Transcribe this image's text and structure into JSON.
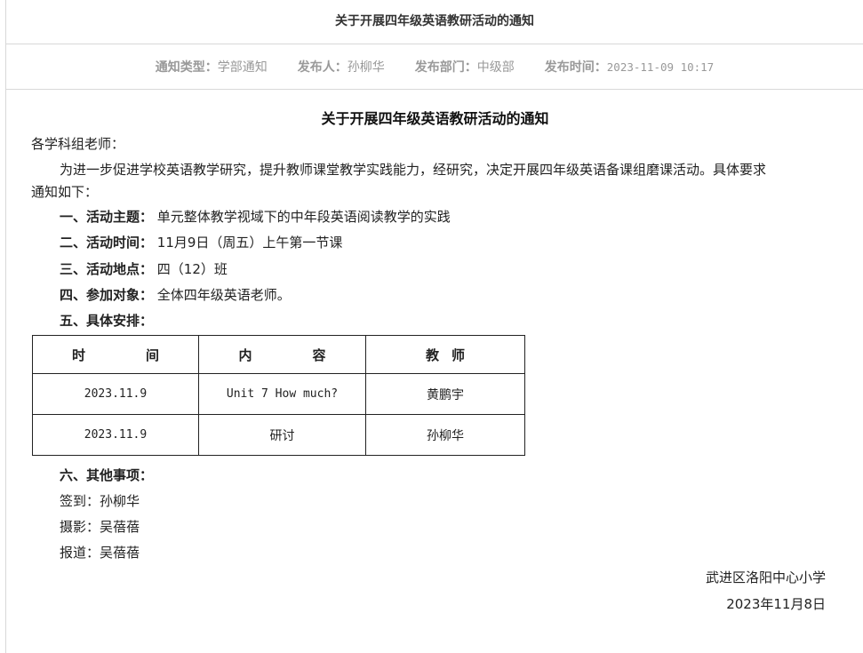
{
  "header": {
    "title": "关于开展四年级英语教研活动的通知"
  },
  "meta": {
    "type_label": "通知类型：",
    "type_value": "学部通知",
    "publisher_label": "发布人：",
    "publisher_value": "孙柳华",
    "dept_label": "发布部门：",
    "dept_value": "中级部",
    "time_label": "发布时间：",
    "time_value": "2023-11-09 10:17"
  },
  "doc": {
    "title": "关于开展四年级英语教研活动的通知",
    "salutation": "各学科组老师：",
    "intro_line1": "为进一步促进学校英语教学研究，提升教师课堂教学实践能力，经研究，决定开展四年级英语备课组磨课活动。具体要求",
    "intro_line2": "通知如下：",
    "items": [
      {
        "label": "一、活动主题：",
        "value": "单元整体教学视域下的中年段英语阅读教学的实践"
      },
      {
        "label": "二、活动时间：",
        "value": "11月9日（周五）上午第一节课"
      },
      {
        "label": "三、活动地点：",
        "value": "四（12）班"
      },
      {
        "label": "四、参加对象：",
        "value": "全体四年级英语老师。"
      },
      {
        "label": "五、具体安排：",
        "value": ""
      }
    ],
    "table": {
      "headers": [
        "时",
        "间",
        "内",
        "容",
        "教",
        "师"
      ],
      "rows": [
        {
          "time": "2023.11.9",
          "content": "Unit 7 How much?",
          "teacher": "黄鹏宇"
        },
        {
          "time": "2023.11.9",
          "content": "研讨",
          "teacher": "孙柳华"
        }
      ]
    },
    "other_label": "六、其他事项：",
    "other_items": [
      "签到：孙柳华",
      "摄影：吴蓓蓓",
      "报道：吴蓓蓓"
    ],
    "signature_org": "武进区洛阳中心小学",
    "signature_date": "2023年11月8日"
  }
}
